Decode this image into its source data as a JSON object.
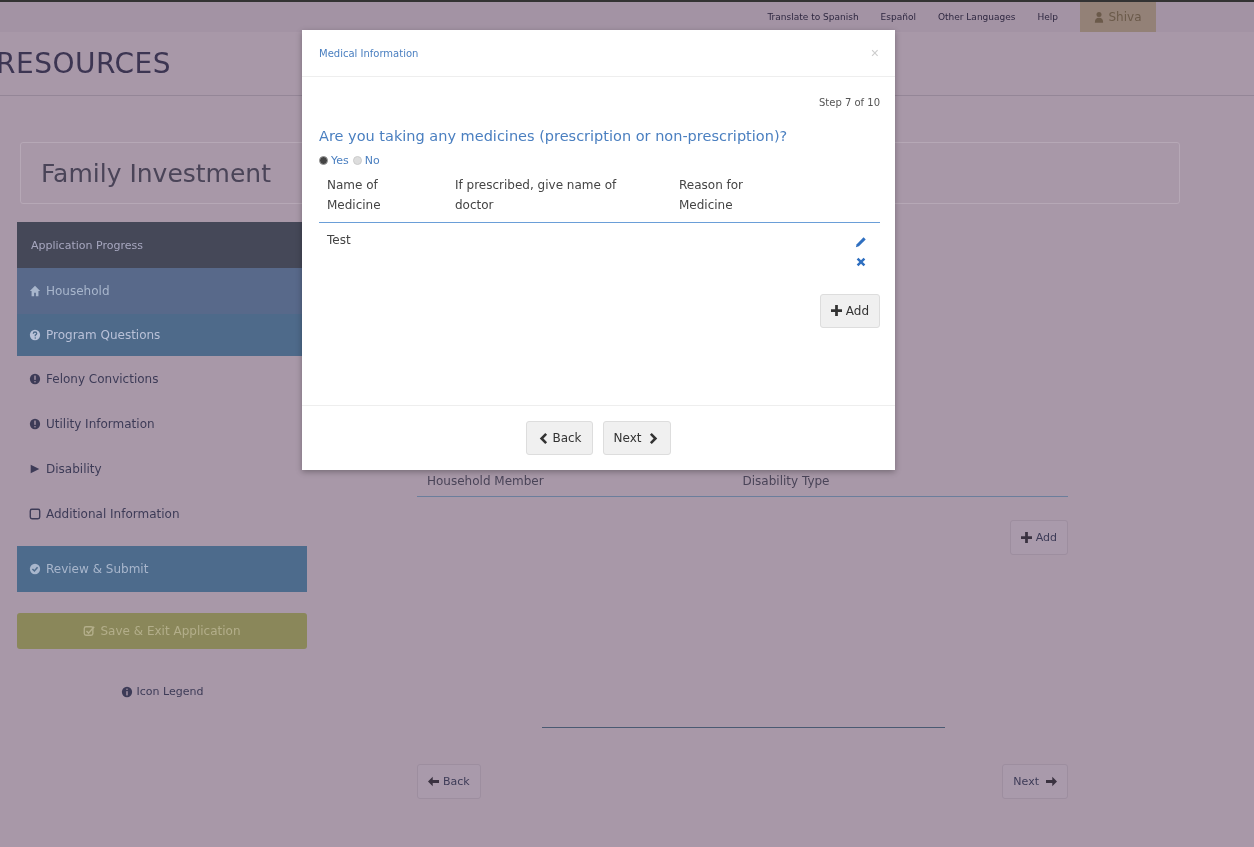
{
  "top_bar": {
    "links": [
      "Translate to Spanish",
      "Español",
      "Other Languages",
      "Help"
    ],
    "user": "Shiva"
  },
  "page_title": "RESOURCES",
  "program_title": "Family Investment",
  "sidebar": {
    "header": "Application Progress",
    "items": [
      {
        "label": "Household",
        "kind": "complete"
      },
      {
        "label": "Program Questions",
        "kind": "current"
      },
      {
        "label": "Felony Convictions",
        "kind": "incomplete"
      },
      {
        "label": "Utility Information",
        "kind": "incomplete"
      },
      {
        "label": "Disability",
        "kind": "active"
      },
      {
        "label": "Additional Information",
        "kind": "not-started"
      },
      {
        "label": "Review & Submit",
        "kind": "review"
      }
    ],
    "save_button": "Save & Exit Application",
    "icon_legend": "Icon Legend"
  },
  "main": {
    "columns": [
      "Household Member",
      "Disability Type"
    ],
    "add_button": "Add",
    "back_button": "Back",
    "next_button": "Next"
  },
  "modal": {
    "title": "Medical Information",
    "close": "×",
    "step": "Step 7 of 10",
    "question": "Are you taking any medicines (prescription or non-prescription)?",
    "options": [
      {
        "label": "Yes",
        "selected": true
      },
      {
        "label": "No",
        "selected": false
      }
    ],
    "columns": [
      "Name of Medicine",
      "If prescribed, give name of doctor",
      "Reason for Medicine"
    ],
    "rows": [
      {
        "name": "Test"
      }
    ],
    "add_button": "Add",
    "back_button": "Back",
    "next_button": "Next"
  }
}
